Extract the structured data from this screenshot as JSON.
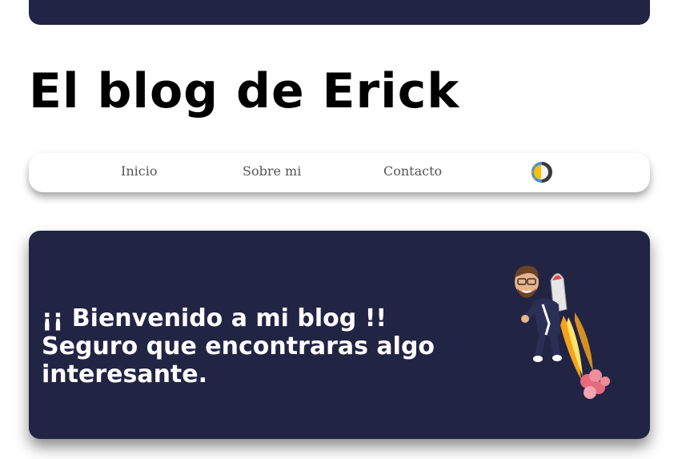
{
  "header": {
    "site_title": "El blog de Erick"
  },
  "nav": {
    "items": [
      {
        "label": "Inicio"
      },
      {
        "label": "Sobre mi"
      },
      {
        "label": "Contacto"
      }
    ],
    "theme_toggle_icon": "sun-moon-icon"
  },
  "hero": {
    "line1": "¡¡ Bienvenido a mi blog !!",
    "line2": "Seguro que encontraras algo",
    "line3": "interesante.",
    "illustration_icon": "avatar-jetpack-icon"
  },
  "colors": {
    "dark_panel": "#222444",
    "page_bg": "#ffffff",
    "title": "#000000",
    "nav_text": "#555555",
    "hero_text": "#ffffff"
  }
}
